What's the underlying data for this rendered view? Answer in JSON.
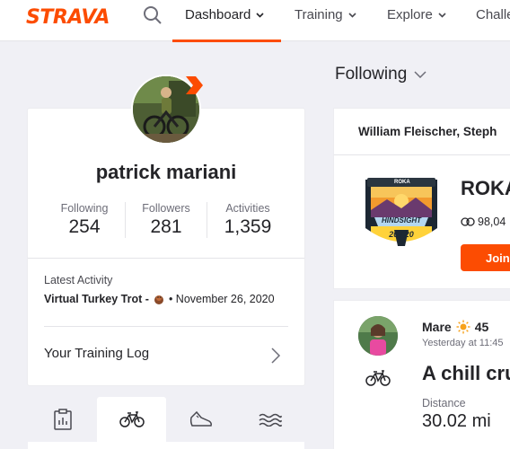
{
  "nav": {
    "logo": "STRAVA",
    "items": [
      {
        "label": "Dashboard"
      },
      {
        "label": "Training"
      },
      {
        "label": "Explore"
      },
      {
        "label": "Challe"
      }
    ]
  },
  "profile": {
    "name": "patrick mariani",
    "stats": [
      {
        "label": "Following",
        "value": "254"
      },
      {
        "label": "Followers",
        "value": "281"
      },
      {
        "label": "Activities",
        "value": "1,359"
      }
    ],
    "latest_activity_label": "Latest Activity",
    "latest_activity_title": "Virtual Turkey Trot -",
    "latest_activity_date": "• November 26, 2020",
    "training_log_label": "Your Training Log"
  },
  "sport_tabs": [
    {
      "icon": "clipboard-icon"
    },
    {
      "icon": "bike-icon"
    },
    {
      "icon": "shoe-icon"
    },
    {
      "icon": "swim-icon"
    }
  ],
  "feed": {
    "filter_label": "Following",
    "club": {
      "members": "William Fleischer, Steph",
      "badge_text_top": "HINDSIGHT",
      "badge_text_bottom": "20 / 20",
      "badge_small": "ROKA",
      "name": "ROKA",
      "stat": "98,04",
      "join_label": "Join"
    },
    "activity": {
      "athlete": "Mare",
      "temperature": "45",
      "time": "Yesterday at 11:45",
      "title": "A chill cru",
      "distance_label": "Distance",
      "distance_value": "30.02 mi"
    }
  },
  "colors": {
    "brand": "#fc4c02",
    "background": "#f0f0f5",
    "text": "#242428"
  }
}
